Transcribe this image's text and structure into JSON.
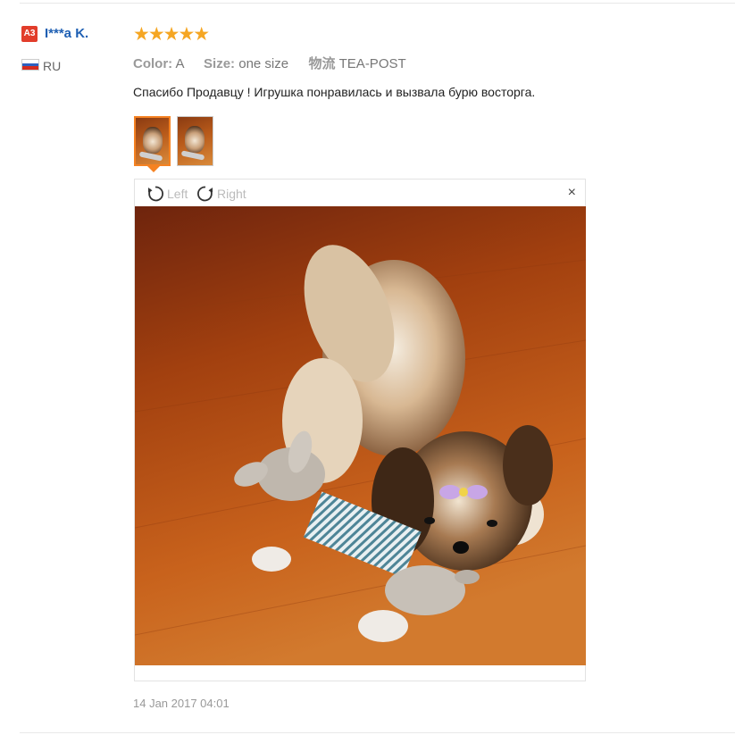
{
  "review": {
    "author": {
      "badge": "A3",
      "name": "I***a K.",
      "country_code": "RU"
    },
    "rating": {
      "stars": 5,
      "stars_text": "★★★★★",
      "color": "#f5a623"
    },
    "attributes": {
      "color_label": "Color:",
      "color_value": "A",
      "size_label": "Size:",
      "size_value": "one size",
      "shipping_label": "物流",
      "shipping_value": "TEA-POST"
    },
    "text": "Спасибо Продавцу ! Игрушка понравилась и вызвала бурю восторга.",
    "thumbnails": [
      {
        "name": "photo-1",
        "selected": true
      },
      {
        "name": "photo-2",
        "selected": false
      }
    ],
    "viewer": {
      "rotate_left_label": "Left",
      "rotate_right_label": "Right",
      "close_label": "×"
    },
    "date": "14 Jan 2017 04:01"
  },
  "colors": {
    "accent_orange": "#f58222",
    "link_blue": "#1e5fb3",
    "badge_red": "#e23d2b"
  }
}
